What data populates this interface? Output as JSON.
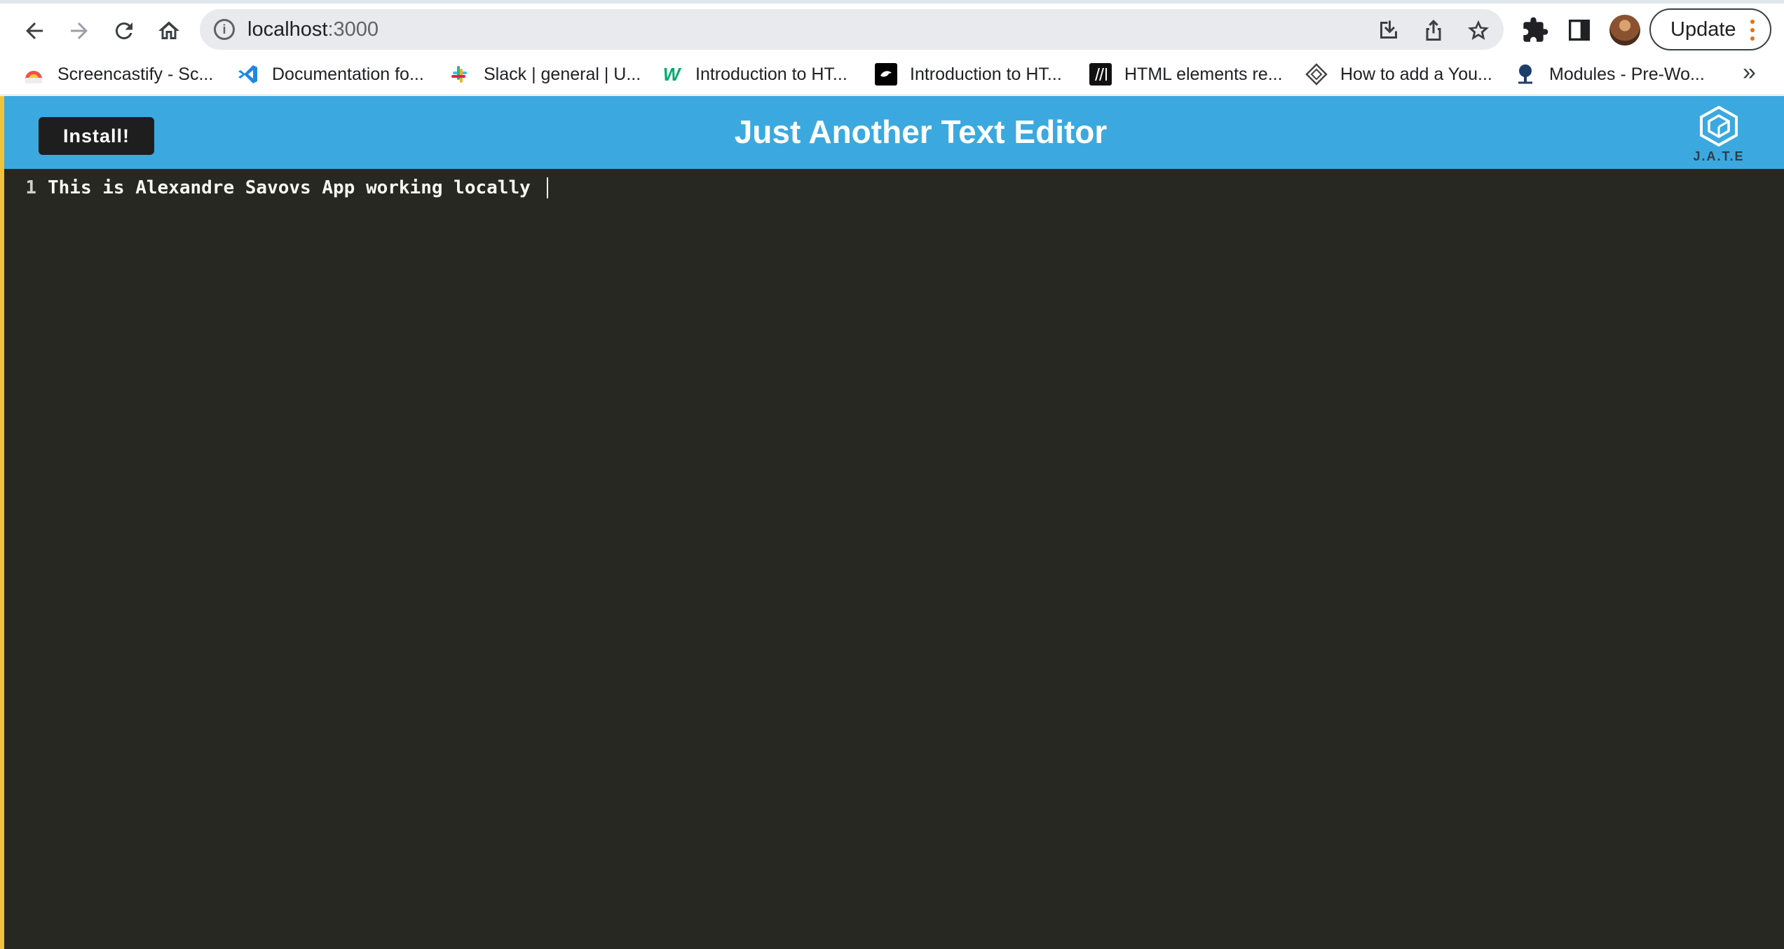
{
  "browser": {
    "url_host": "localhost",
    "url_port": ":3000",
    "update_label": "Update"
  },
  "bookmarks": [
    {
      "label": "Screencastify - Sc...",
      "icon": "screencastify-icon"
    },
    {
      "label": "Documentation fo...",
      "icon": "vscode-icon"
    },
    {
      "label": "Slack | general | U...",
      "icon": "slack-icon"
    },
    {
      "label": "Introduction to HT...",
      "icon": "w3schools-icon"
    },
    {
      "label": "Introduction to HT...",
      "icon": "codecademy-icon"
    },
    {
      "label": "HTML elements re...",
      "icon": "mdn-icon"
    },
    {
      "label": "How to add a You...",
      "icon": "site-icon"
    },
    {
      "label": "Modules - Pre-Wo...",
      "icon": "tree-icon"
    }
  ],
  "bookmarks_more": "»",
  "app": {
    "install_label": "Install!",
    "title": "Just Another Text Editor",
    "logo_text": "J.A.T.E",
    "editor_lines": [
      {
        "number": "1",
        "text": "This is Alexandre Savovs App working locally "
      }
    ]
  },
  "colors": {
    "header_bg": "#3ba9df",
    "editor_bg": "#272822",
    "install_bg": "#1e1e1e",
    "left_accent": "#f3c23b"
  }
}
